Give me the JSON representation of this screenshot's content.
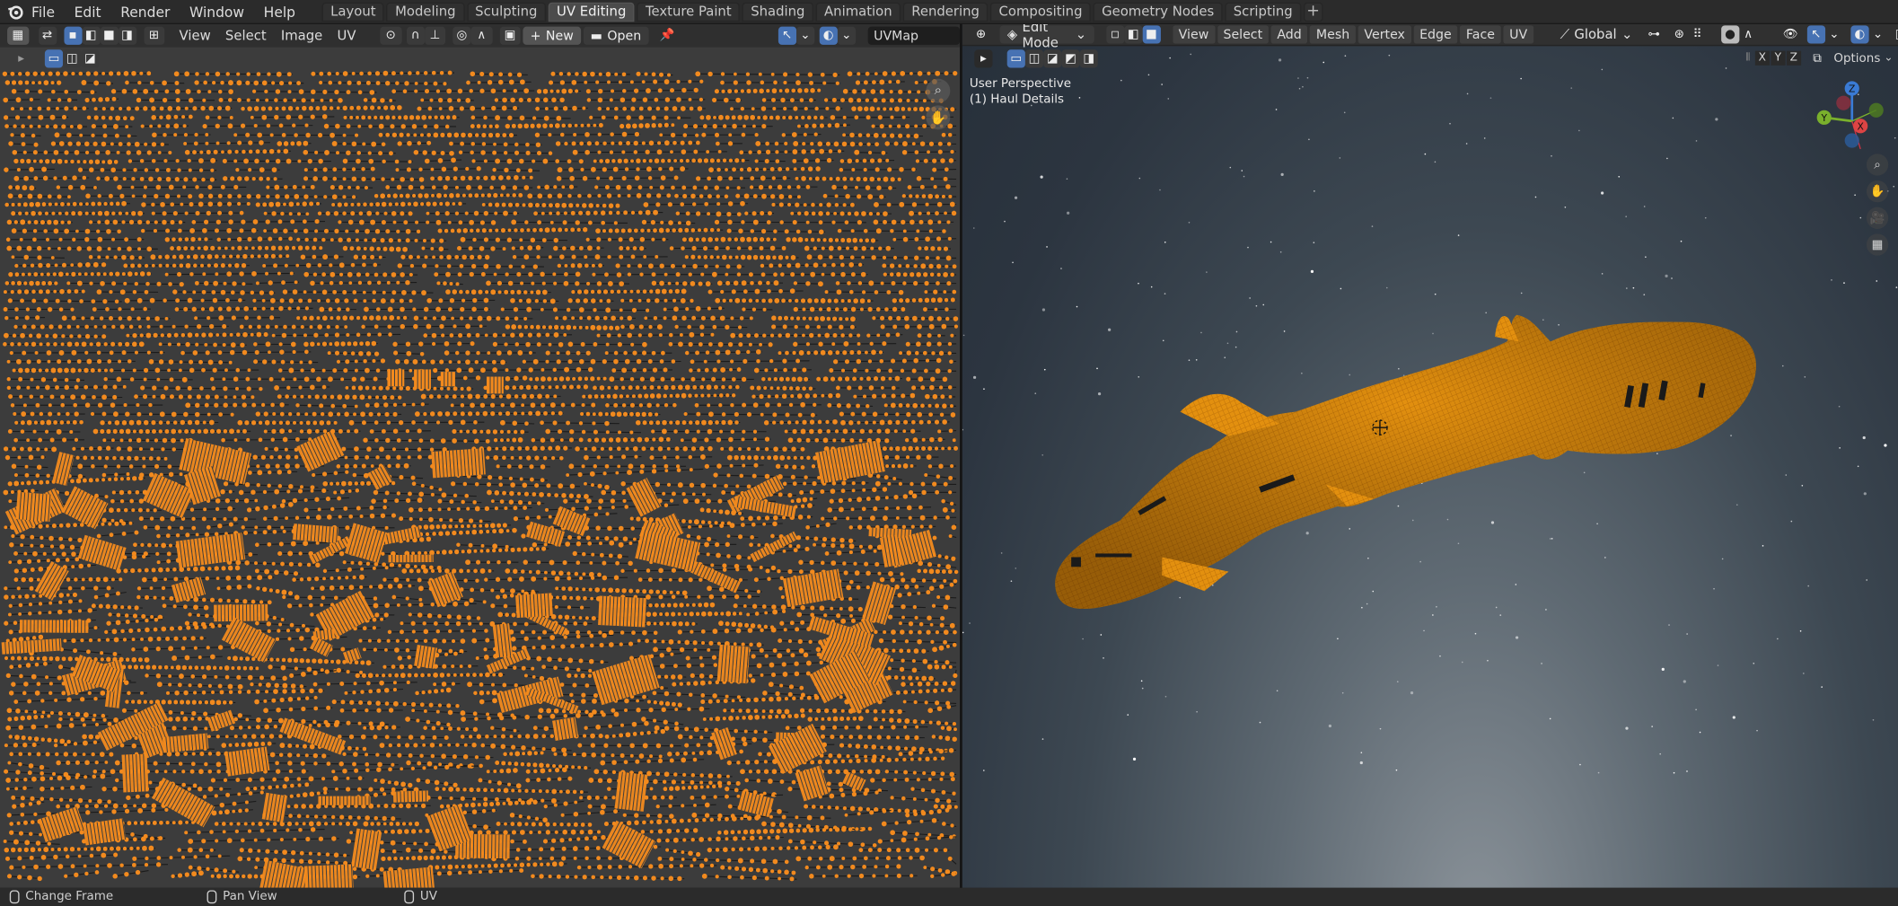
{
  "menu": [
    "File",
    "Edit",
    "Render",
    "Window",
    "Help"
  ],
  "workspace_tabs": [
    {
      "label": "Layout",
      "active": false
    },
    {
      "label": "Modeling",
      "active": false
    },
    {
      "label": "Sculpting",
      "active": false
    },
    {
      "label": "UV Editing",
      "active": true
    },
    {
      "label": "Texture Paint",
      "active": false
    },
    {
      "label": "Shading",
      "active": false
    },
    {
      "label": "Animation",
      "active": false
    },
    {
      "label": "Rendering",
      "active": false
    },
    {
      "label": "Compositing",
      "active": false
    },
    {
      "label": "Geometry Nodes",
      "active": false
    },
    {
      "label": "Scripting",
      "active": false
    }
  ],
  "uv_editor": {
    "menus": [
      "View",
      "Select",
      "Image",
      "UV"
    ],
    "new_label": "New",
    "open_label": "Open",
    "uvmap_name": "UVMap",
    "uv_color": "#f28a1e",
    "bg_color": "#3c3c3c"
  },
  "viewport": {
    "mode": "Edit Mode",
    "menus": [
      "View",
      "Select",
      "Add",
      "Mesh",
      "Vertex",
      "Edge",
      "Face",
      "UV"
    ],
    "orientation": "Global",
    "options_label": "Options",
    "perspective": "User Perspective",
    "object_info": "(1) Haul Details",
    "axis_labels": [
      "X",
      "Y",
      "Z"
    ],
    "mesh_color": "#e08a12"
  },
  "statusbar": {
    "items": [
      "Change Frame",
      "Pan View",
      "UV"
    ]
  }
}
